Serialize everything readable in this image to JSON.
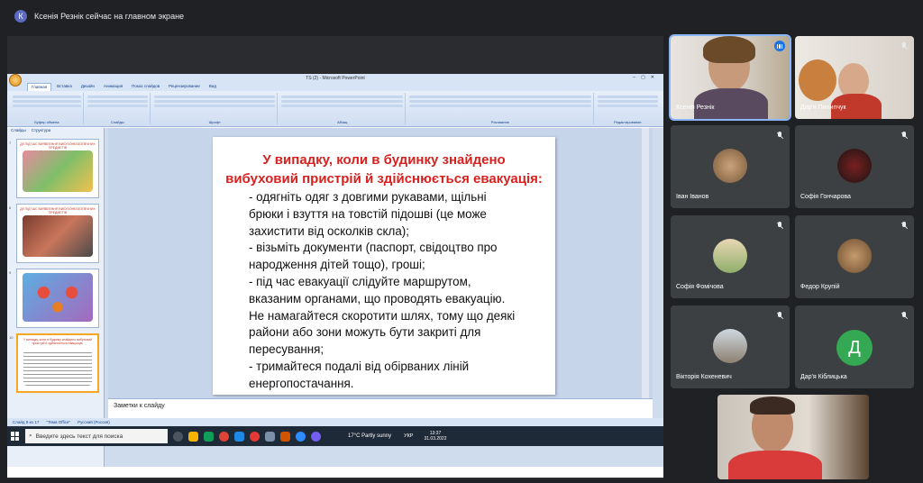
{
  "presenter": {
    "initial": "К",
    "banner": "Ксенія Резнік сейчас на главном экране"
  },
  "ppt": {
    "window_title": "TS (2) - Microsoft PowerPoint",
    "tabs": [
      "Главная",
      "Вставка",
      "Дизайн",
      "Анимация",
      "Показ слайдов",
      "Рецензирование",
      "Вид"
    ],
    "ribbon_groups": [
      "Буфер обмена",
      "Слайды",
      "Шрифт",
      "Абзац",
      "Рисование",
      "Редактирование"
    ],
    "panel_tabs": [
      "Слайды",
      "Структура"
    ],
    "thumbnails": [
      {
        "num": "7",
        "title": "ДІЇ ПІД ЧАС ВИЯВЛЕННЯ ВИБУХОНЕБЕЗПЕЧНИХ ПРЕДМЕТІВ"
      },
      {
        "num": "8",
        "title": "ДІЇ ПІД ЧАС ВИЯВЛЕННЯ ВИБУХОНЕБЕЗПЕЧНИХ ПРЕДМЕТІВ"
      },
      {
        "num": "9",
        "title": ""
      },
      {
        "num": "10",
        "title": "У випадку, коли в будинку знайдено вибуховий пристрій й здійснюється евакуація:"
      }
    ],
    "slide": {
      "title_lines": [
        "У випадку, коли в будинку знайдено",
        "вибуховий пристрій й здійснюється евакуація:"
      ],
      "body_lines": [
        "- одягніть одяг з довгими рукавами, щільні",
        "брюки і взуття на товстій підошві (це може",
        "захистити від осколків скла);",
        "- візьміть документи (паспорт, свідоцтво про",
        "народження дітей тощо), гроші;",
        "- під час евакуації слідуйте маршрутом,",
        "вказаним органами, що проводять евакуацію.",
        "Не намагайтеся скоротити шлях, тому що деякі",
        "райони або зони можуть бути закриті для",
        "пересування;",
        "- тримайтеся подалі від обірваних ліній",
        "енергопостачання."
      ]
    },
    "notes_placeholder": "Заметки к слайду",
    "status": [
      "Слайд 9 из 17",
      "\"Тема Office\"",
      "Русский (Россия)"
    ]
  },
  "taskbar": {
    "search_placeholder": "Введите здесь текст для поиска",
    "weather": "17°C  Partly sunny",
    "lang": "УКР",
    "time": "13:37",
    "date": "31.03.2022"
  },
  "participants": [
    {
      "name": "Ксенія Резнік",
      "type": "video",
      "speaking": true
    },
    {
      "name": "Дар'я Пилипчук",
      "type": "video",
      "muted": true
    },
    {
      "name": "Іван Іванов",
      "type": "avatar",
      "muted": true,
      "color": "#7a5a3a"
    },
    {
      "name": "Софія Гончарова",
      "type": "avatar",
      "muted": true,
      "color": "#2a2020"
    },
    {
      "name": "Софія Фомічова",
      "type": "avatar",
      "muted": true,
      "color": "#b9a27a"
    },
    {
      "name": "Федор Крупій",
      "type": "avatar",
      "muted": true,
      "color": "#8a6a48"
    },
    {
      "name": "Вікторія Кохеневич",
      "type": "avatar",
      "muted": true,
      "color": "#9aa7b3"
    },
    {
      "name": "Дар'я Кіблицька",
      "type": "letter",
      "letter": "Д",
      "muted": true
    }
  ],
  "self_view": {
    "name": ""
  }
}
